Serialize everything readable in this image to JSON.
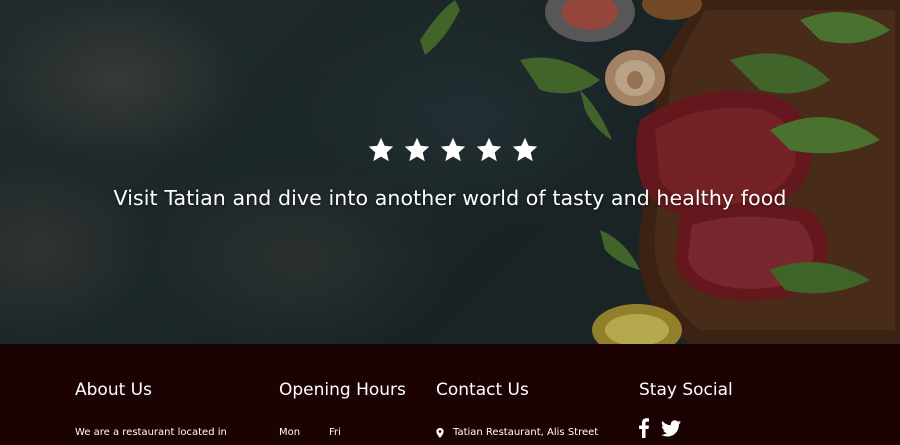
{
  "hero": {
    "rating_stars": 5,
    "tagline": "Visit Tatian and dive into another world of tasty and healthy food"
  },
  "footer": {
    "about": {
      "title": "About Us",
      "text": "We are a restaurant located in"
    },
    "hours": {
      "title": "Opening Hours",
      "rows": [
        {
          "from": "Mon",
          "to": "Fri"
        }
      ]
    },
    "contact": {
      "title": "Contact Us",
      "address": "Tatian Restaurant, Alis Street",
      "address_icon": "map-pin-icon"
    },
    "social": {
      "title": "Stay Social",
      "icons": [
        "facebook-icon",
        "twitter-icon"
      ]
    }
  },
  "colors": {
    "footer_bg": "#1b0303",
    "text": "#ffffff"
  }
}
